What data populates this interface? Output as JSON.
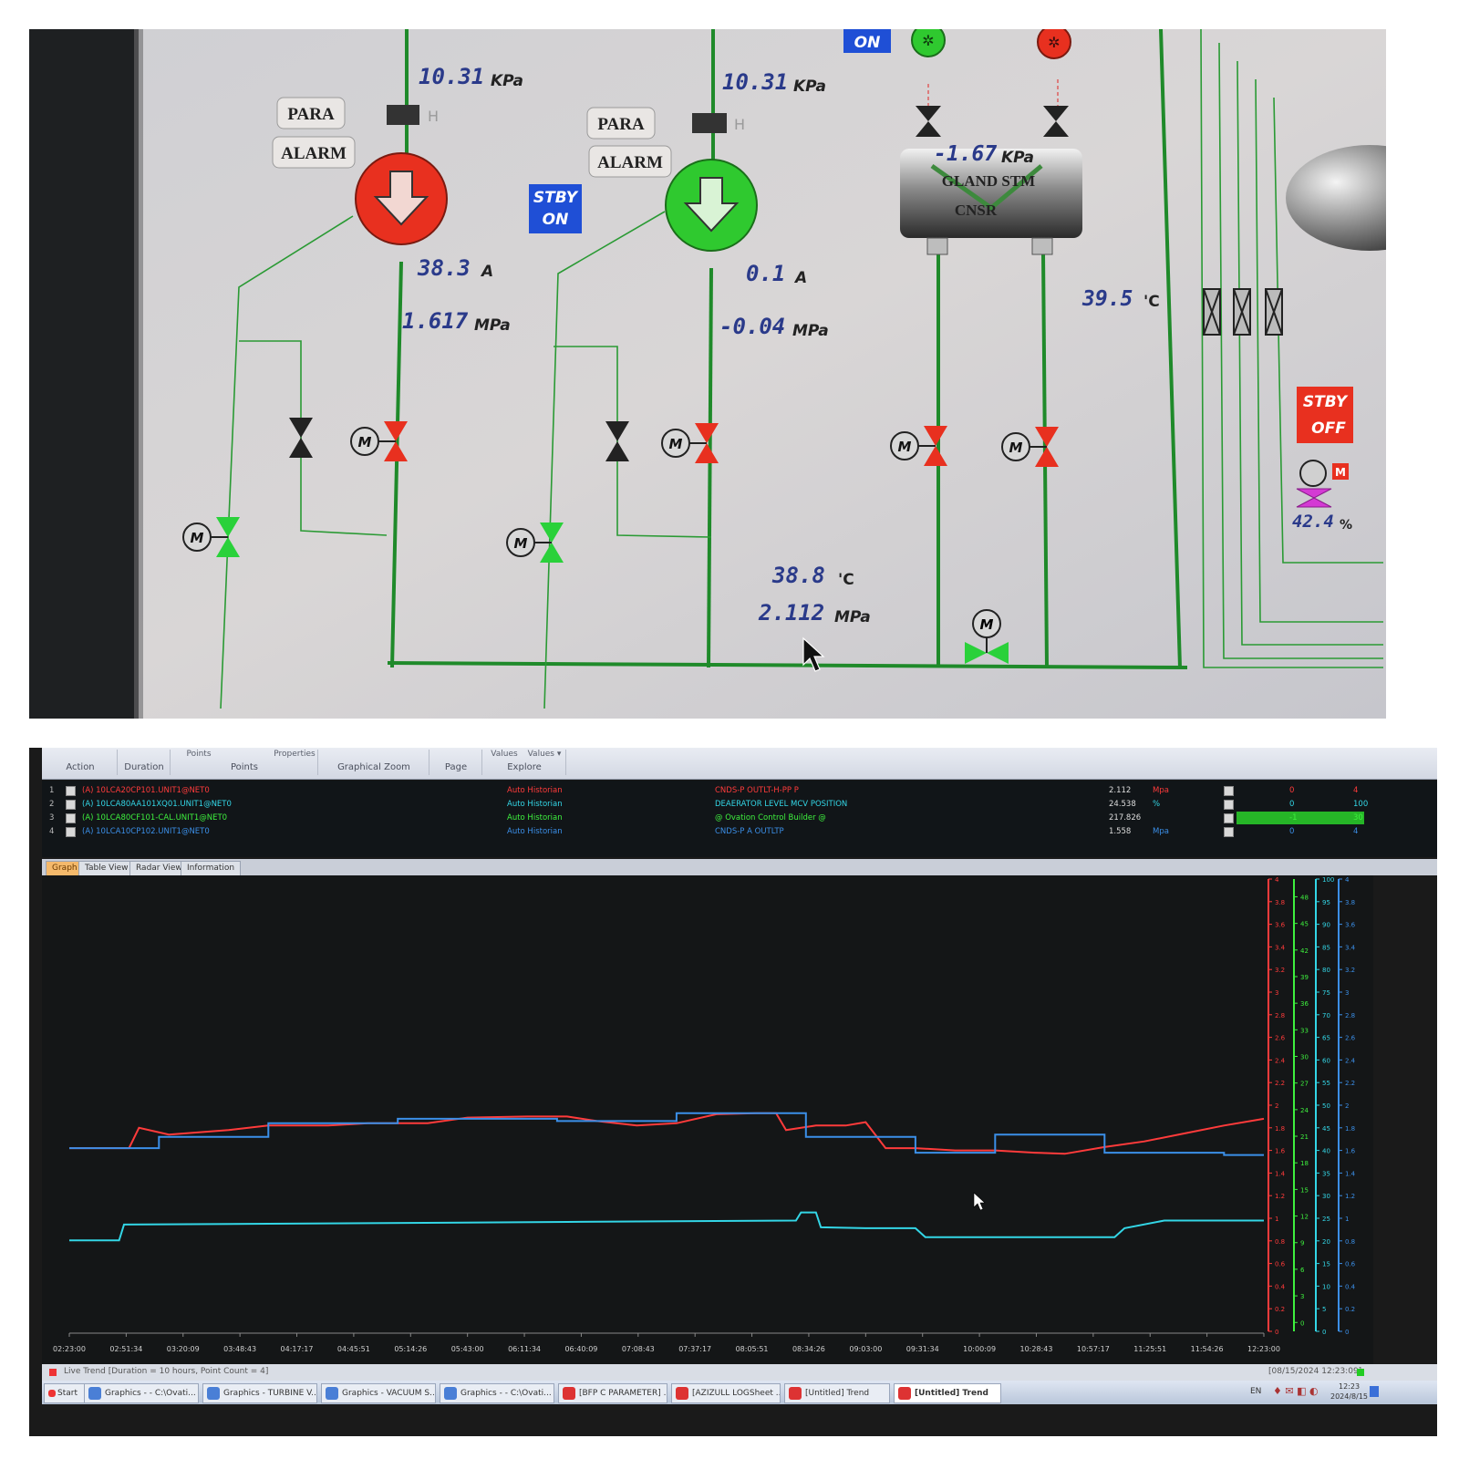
{
  "scada": {
    "pump_a": {
      "para_label": "PARA",
      "alarm_label": "ALARM",
      "inlet_pressure": "10.31",
      "inlet_pressure_unit": "KPa",
      "current": "38.3",
      "current_unit": "A",
      "outlet_pressure": "1.617",
      "outlet_pressure_unit": "MPa",
      "h_mark": "H",
      "state_color": "#e8301f"
    },
    "pump_b": {
      "para_label": "PARA",
      "alarm_label": "ALARM",
      "inlet_pressure": "10.31",
      "inlet_pressure_unit": "KPa",
      "current": "0.1",
      "current_unit": "A",
      "outlet_pressure": "-0.04",
      "outlet_pressure_unit": "MPa",
      "h_mark": "H",
      "standby_line1": "STBY",
      "standby_line2": "ON",
      "state_color": "#2fc92f"
    },
    "top_on_label": "ON",
    "gland": {
      "pressure": "-1.67",
      "pressure_unit": "KPa",
      "label_line1": "GLAND STM",
      "label_line2": "CNSR"
    },
    "right_temp": "39.5",
    "right_temp_unit": "'C",
    "stby_off_line1": "STBY",
    "stby_off_line2": "OFF",
    "valve_position": "42.4",
    "valve_position_unit": "%",
    "valve_flag": "M",
    "header_temp": "38.8",
    "header_temp_unit": "'C",
    "header_pressure": "2.112",
    "header_pressure_unit": "MPa",
    "motor_letter": "M"
  },
  "trend": {
    "toolbar": {
      "groups": [
        "Action",
        "Duration",
        "Points",
        "Graphical Zoom",
        "Page",
        "Explore"
      ],
      "top_labels": [
        "Points",
        "Properties",
        "Values",
        "Values ▾"
      ]
    },
    "pens": [
      {
        "index": "1",
        "tag": "(A) 10LCA20CP101.UNIT1@NET0",
        "source": "Auto Historian",
        "desc": "CNDS-P OUTLT-H-PP P",
        "value": "2.112",
        "unit": "Mpa",
        "low": "0",
        "high": "4",
        "color": "#ff3b3b"
      },
      {
        "index": "2",
        "tag": "(A) 10LCA80AA101XQ01.UNIT1@NET0",
        "source": "Auto Historian",
        "desc": "DEAERATOR LEVEL MCV POSITION",
        "value": "24.538",
        "unit": "%",
        "low": "0",
        "high": "100",
        "color": "#33d6e6"
      },
      {
        "index": "3",
        "tag": "(A) 10LCA80CF101-CAL.UNIT1@NET0",
        "source": "Auto Historian",
        "desc": "@ Ovation Control Builder @",
        "value": "217.826",
        "unit": "",
        "low": "-1",
        "high": "30",
        "color": "#3ef03e"
      },
      {
        "index": "4",
        "tag": "(A) 10LCA10CP102.UNIT1@NET0",
        "source": "Auto Historian",
        "desc": "CNDS-P A OUTLTP",
        "value": "1.558",
        "unit": "Mpa",
        "low": "0",
        "high": "4",
        "color": "#3b8fe8"
      }
    ],
    "tabs": [
      "Graph",
      "Table View",
      "Radar View",
      "Information"
    ],
    "status_text": "Live Trend [Duration = 10 hours, Point Count = 4]",
    "status_timestamp": "[08/15/2024 12:23:09]",
    "taskbar": {
      "start": "Start",
      "items": [
        "Graphics - - C:\\Ovati...",
        "Graphics - TURBINE V...",
        "Graphics - VACUUM S...",
        "Graphics - - C:\\Ovati...",
        "[BFP C PARAMETER] ...",
        "[AZIZULL LOGSheet ...",
        "[Untitled] Trend",
        "[Untitled] Trend"
      ],
      "lang": "EN",
      "clock_time": "12:23",
      "clock_date": "2024/8/15"
    }
  },
  "chart_data": {
    "type": "line",
    "x_ticks": [
      "02:23:00",
      "02:51:34",
      "03:20:09",
      "03:48:43",
      "04:17:17",
      "04:45:51",
      "05:14:26",
      "05:43:00",
      "06:11:34",
      "06:40:09",
      "07:08:43",
      "07:37:17",
      "08:05:51",
      "08:34:26",
      "09:03:00",
      "09:31:34",
      "10:00:09",
      "10:28:43",
      "10:57:17",
      "11:25:51",
      "11:54:26",
      "12:23:00"
    ],
    "axes": [
      {
        "name": "red-axis",
        "color": "#ff3b3b",
        "min": 0,
        "max": 4,
        "ticks": [
          "0",
          "0.2",
          "0.4",
          "0.6",
          "0.8",
          "1",
          "1.2",
          "1.4",
          "1.6",
          "1.8",
          "2",
          "2.2",
          "2.4",
          "2.6",
          "2.8",
          "3",
          "3.2",
          "3.4",
          "3.6",
          "3.8",
          "4"
        ]
      },
      {
        "name": "green-axis",
        "color": "#3ef03e",
        "min": -1,
        "max": 50,
        "ticks": [
          "0",
          "3",
          "6",
          "9",
          "12",
          "15",
          "18",
          "21",
          "24",
          "27",
          "30",
          "33",
          "36",
          "39",
          "42",
          "45",
          "48"
        ]
      },
      {
        "name": "cyan-axis",
        "color": "#33d6e6",
        "min": 0,
        "max": 100,
        "ticks": [
          "0",
          "5",
          "10",
          "15",
          "20",
          "25",
          "30",
          "35",
          "40",
          "45",
          "50",
          "55",
          "60",
          "65",
          "70",
          "75",
          "80",
          "85",
          "90",
          "95",
          "100"
        ]
      },
      {
        "name": "blue-axis",
        "color": "#3b8fe8",
        "min": 0,
        "max": 4,
        "ticks": [
          "0",
          "0.2",
          "0.4",
          "0.6",
          "0.8",
          "1",
          "1.2",
          "1.4",
          "1.6",
          "1.8",
          "2",
          "2.2",
          "2.4",
          "2.6",
          "2.8",
          "3",
          "3.2",
          "3.4",
          "3.6",
          "3.8",
          "4"
        ]
      }
    ],
    "series": [
      {
        "name": "CNDS-P OUTLT-H-PP P",
        "color": "#ff3b3b",
        "axis": 0,
        "x": [
          0,
          0.6,
          0.7,
          1.0,
          1.6,
          2.0,
          2.6,
          3.0,
          3.6,
          4.0,
          4.6,
          5.0,
          5.3,
          5.7,
          6.1,
          6.5,
          6.9,
          7.1,
          7.2,
          7.5,
          7.8,
          8.0,
          8.2,
          8.5,
          8.9,
          9.3,
          9.7,
          10.0,
          10.4,
          10.8,
          11.2,
          11.6,
          12.0
        ],
        "y": [
          1.62,
          1.62,
          1.8,
          1.74,
          1.78,
          1.82,
          1.82,
          1.84,
          1.84,
          1.89,
          1.9,
          1.9,
          1.86,
          1.82,
          1.84,
          1.92,
          1.93,
          1.93,
          1.78,
          1.82,
          1.82,
          1.85,
          1.62,
          1.62,
          1.6,
          1.6,
          1.58,
          1.57,
          1.63,
          1.68,
          1.75,
          1.82,
          1.88
        ]
      },
      {
        "name": "CNDS-P A OUTLTP",
        "color": "#3b8fe8",
        "axis": 3,
        "x": [
          0,
          0.9,
          0.9,
          2.0,
          2.0,
          3.3,
          3.3,
          4.9,
          4.9,
          6.1,
          6.1,
          7.4,
          7.4,
          8.5,
          8.5,
          9.3,
          9.3,
          10.4,
          10.4,
          11.6,
          11.6,
          12.0
        ],
        "y": [
          1.62,
          1.62,
          1.72,
          1.72,
          1.84,
          1.84,
          1.88,
          1.88,
          1.86,
          1.86,
          1.93,
          1.93,
          1.72,
          1.72,
          1.58,
          1.58,
          1.74,
          1.74,
          1.58,
          1.58,
          1.56,
          1.56
        ]
      },
      {
        "name": "DEAERATOR LEVEL MCV POSITION",
        "color": "#33d6e6",
        "axis": 2,
        "x": [
          0,
          0.5,
          0.55,
          2.0,
          5.0,
          7.3,
          7.35,
          7.5,
          7.55,
          8.0,
          8.5,
          8.6,
          9.6,
          10.0,
          10.5,
          10.6,
          11.0,
          11.5,
          12.0
        ],
        "y": [
          20.1,
          20.1,
          23.6,
          23.8,
          24.2,
          24.5,
          26.3,
          26.3,
          23.0,
          22.8,
          22.8,
          20.8,
          20.8,
          20.8,
          20.8,
          22.8,
          24.5,
          24.5,
          24.5
        ]
      }
    ]
  }
}
